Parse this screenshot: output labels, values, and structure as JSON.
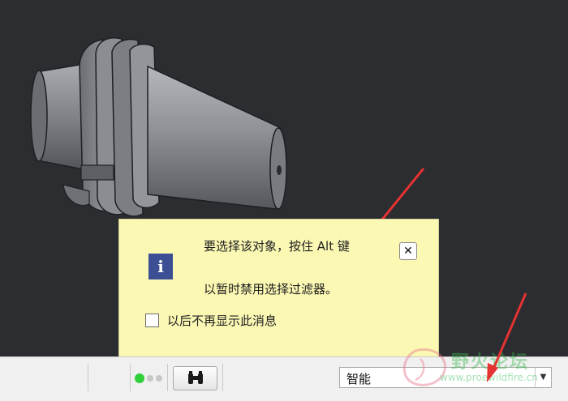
{
  "popup": {
    "message_line1": "要选择该对象，按住 Alt 键",
    "message_line2": "以暂时禁用选择过滤器。",
    "dont_show_label": "以后不再显示此消息",
    "dont_show_checked": false,
    "close_glyph": "✕",
    "info_glyph": "i"
  },
  "statusbar": {
    "indicator_state": "active",
    "find_icon": "binoculars-icon",
    "filter": {
      "selected": "智能",
      "arrow_glyph": "▼"
    }
  },
  "watermark": {
    "title": "野火论坛",
    "url": "www.proewildfire.cn"
  },
  "colors": {
    "viewport_bg": "#2b2d30",
    "popup_bg": "#fbf8b4",
    "arrow_red": "#e53232",
    "led_green": "#2fcf3a"
  }
}
